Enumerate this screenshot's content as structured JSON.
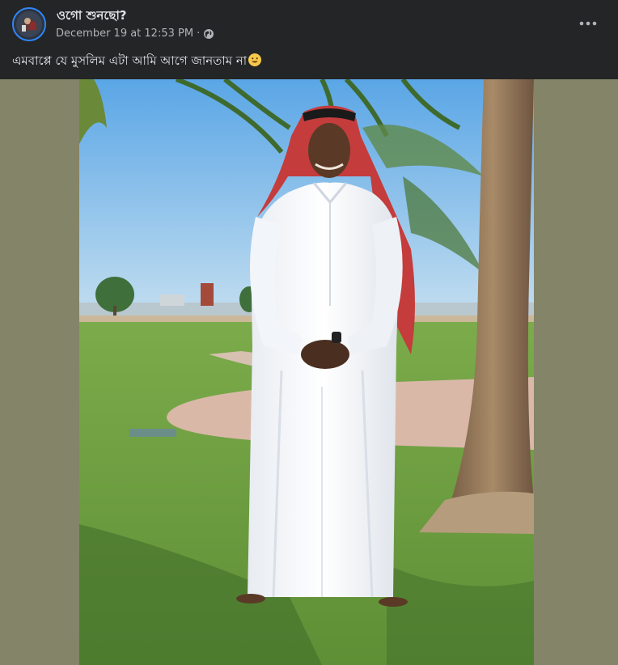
{
  "post": {
    "author": "ওগো শুনছো?",
    "date": "December 19 at 12:53 PM",
    "separator": "·",
    "caption": "এমবাপ্পে যে মুসলিম এটা আমি আগে জানতাম না",
    "icons": {
      "privacy": "globe-icon",
      "options": "more-horizontal-icon",
      "emoji": "smiling-face-emoji"
    },
    "photo": {
      "subject": "man in white thobe and red checkered keffiyeh standing barefoot on grass beside a palm tree"
    }
  },
  "colors": {
    "background": "#242526",
    "text_primary": "#e4e6eb",
    "text_secondary": "#b0b3b8",
    "avatar_ring": "#2d88ff",
    "media_letterbox": "#848469"
  }
}
